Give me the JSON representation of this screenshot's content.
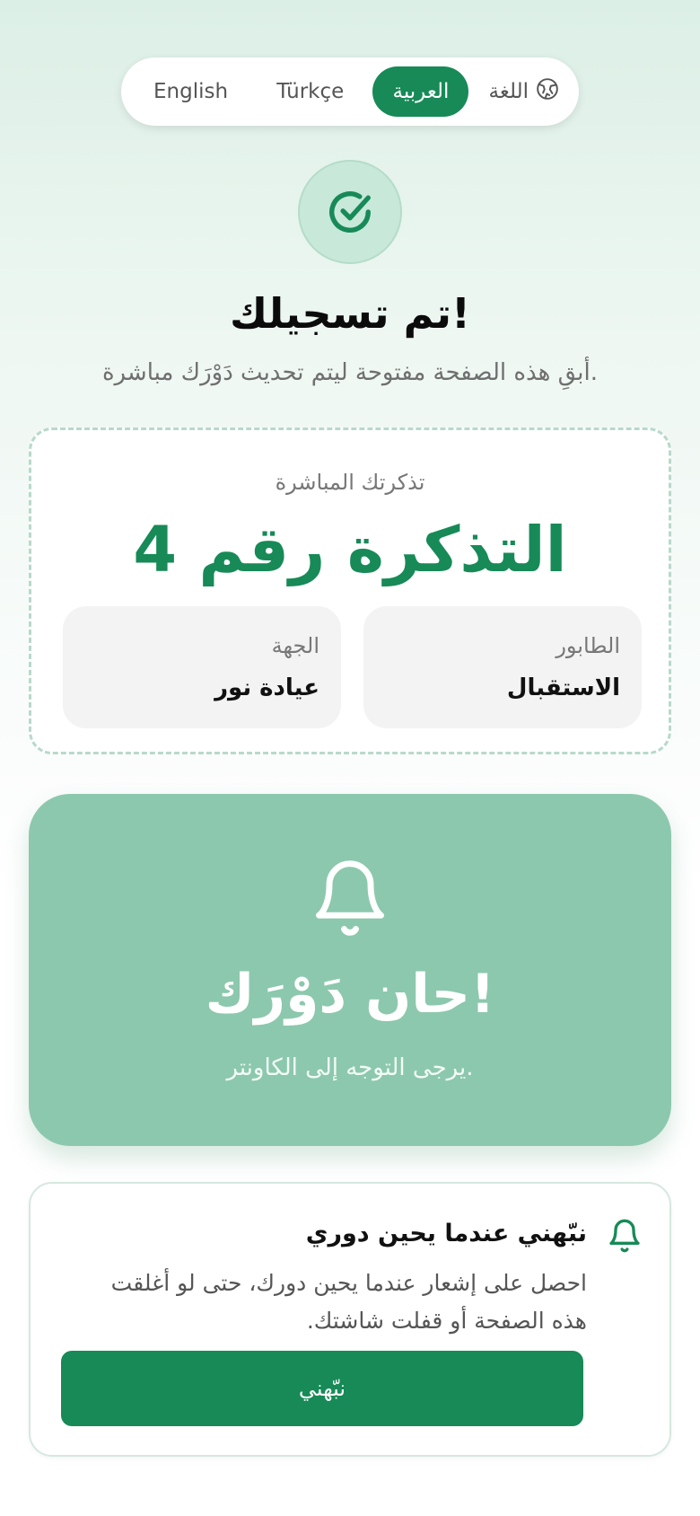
{
  "language_bar": {
    "options": [
      "English",
      "Türkçe",
      "العربية"
    ],
    "active": "العربية",
    "label": "اللغة",
    "icon": "globe-icon"
  },
  "status": {
    "icon": "check-circle-icon",
    "title": "تم تسجيلك!",
    "subtitle": "أبقِ هذه الصفحة مفتوحة ليتم تحديث دَوْرَك مباشرة."
  },
  "ticket": {
    "label": "تذكرتك المباشرة",
    "number": "التذكرة رقم 4",
    "queue_label": "الطابور",
    "queue_value": "الاستقبال",
    "entity_label": "الجهة",
    "entity_value": "عيادة نور"
  },
  "turn_alert": {
    "icon": "bell-icon",
    "title": "حان دَوْرَك!",
    "subtitle": "يرجى التوجه إلى الكاونتر."
  },
  "notify": {
    "icon": "bell-icon",
    "title": "نبّهني عندما يحين دوري",
    "description": "احصل على إشعار عندما يحين دورك، حتى لو أغلقت هذه الصفحة أو قفلت شاشتك.",
    "button_label": "نبّهني"
  },
  "colors": {
    "accent": "#178a57",
    "turn_card": "#8cc8ad",
    "check_bg": "#c8e8da"
  }
}
